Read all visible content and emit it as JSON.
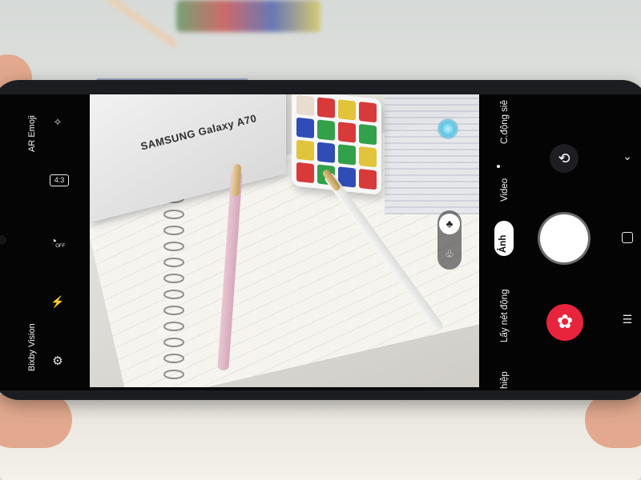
{
  "viewfinder_scene": {
    "box_text": "SAMSUNG Galaxy A70"
  },
  "left_panel": {
    "ar_emoji_label": "AR Emoji",
    "bixby_vision_label": "Bixby Vision",
    "ratio_label": "4:3",
    "timer_label": "OFF",
    "icons": [
      "magic-wand-icon",
      "aspect-ratio-icon",
      "timer-off-icon",
      "flash-off-icon",
      "settings-icon"
    ]
  },
  "right_panel": {
    "modes": {
      "slow_motion": "C.động siê",
      "video": "Video",
      "photo": "Ảnh",
      "live_focus": "Lấy nét động",
      "hiep": "hiệp"
    },
    "icons": [
      "switch-camera-icon",
      "shutter-button",
      "bixby-icon",
      "chevron-down-icon",
      "home-icon",
      "recent-apps-icon"
    ]
  },
  "colors": {
    "bixby_red": "#e8243c",
    "screen_black": "#050506",
    "bixby_dot": "#5fc6e8"
  }
}
